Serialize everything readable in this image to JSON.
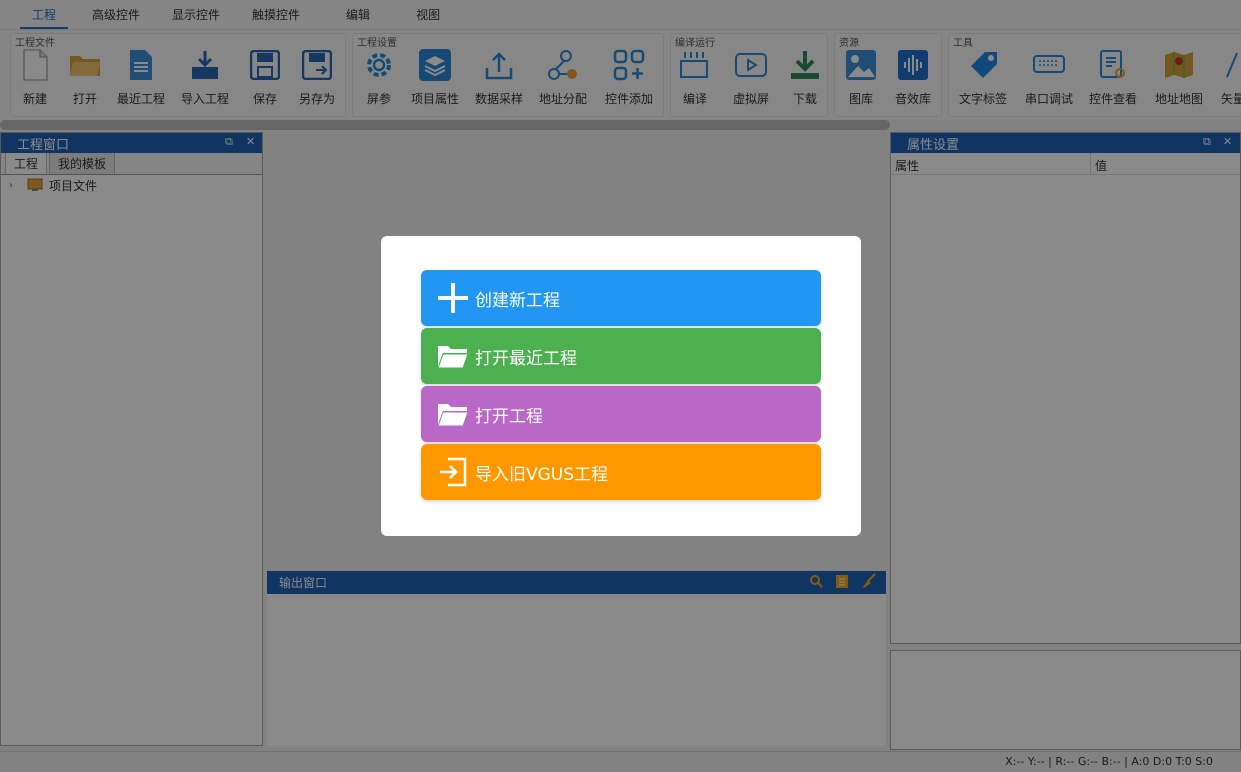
{
  "menu": {
    "tabs": [
      "工程",
      "高级控件",
      "显示控件",
      "触摸控件",
      "编辑",
      "视图"
    ]
  },
  "ribbon": {
    "groups": [
      {
        "title": "工程文件",
        "buttons": [
          "新建",
          "打开",
          "最近工程",
          "导入工程",
          "保存",
          "另存为"
        ]
      },
      {
        "title": "工程设置",
        "buttons": [
          "屏参",
          "项目属性",
          "数据采样",
          "地址分配",
          "控件添加"
        ]
      },
      {
        "title": "编译运行",
        "buttons": [
          "编译",
          "虚拟屏",
          "下载"
        ]
      },
      {
        "title": "资源",
        "buttons": [
          "图库",
          "音效库"
        ]
      },
      {
        "title": "工具",
        "buttons": [
          "文字标签",
          "串口调试",
          "控件查看",
          "地址地图",
          "矢量"
        ]
      }
    ]
  },
  "left_panel": {
    "title": "工程窗口",
    "tabs": [
      "工程",
      "我的模板"
    ],
    "tree": [
      "项目文件"
    ]
  },
  "output_panel": {
    "title": "输出窗口"
  },
  "right_panel": {
    "title": "属性设置",
    "col_property": "属性",
    "col_value": "值"
  },
  "statusbar": {
    "text": "X:--  Y:--  |  R:-- G:-- B:--  |  A:0  D:0  T:0  S:0"
  },
  "modal": {
    "buttons": [
      {
        "label": "创建新工程",
        "color": "#2196f3",
        "icon": "plus-icon"
      },
      {
        "label": "打开最近工程",
        "color": "#4caf50",
        "icon": "folder-open-icon"
      },
      {
        "label": "打开工程",
        "color": "#ba68c8",
        "icon": "folder-open-icon"
      },
      {
        "label": "导入旧VGUS工程",
        "color": "#ff9800",
        "icon": "import-icon"
      }
    ]
  }
}
